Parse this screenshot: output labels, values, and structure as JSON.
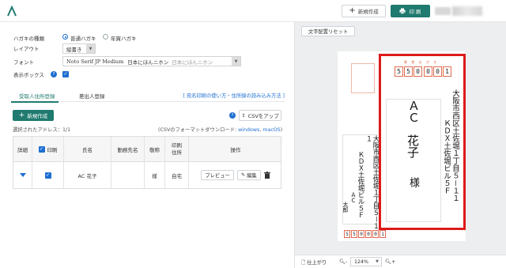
{
  "header": {
    "new_button": "新規作成",
    "print_button": "印 刷"
  },
  "form": {
    "hagaki_type_label": "ハガキの種類",
    "hagaki_options": [
      "普通ハガキ",
      "年賀ハガキ"
    ],
    "layout_label": "レイアウト",
    "layout_value": "縦書き",
    "font_label": "フォント",
    "font_value": "Noto Serif JP Medium",
    "font_sample": "日本にほんニホン",
    "font_sample2": "日本にほんニホン",
    "display_box_label": "表示ボックス"
  },
  "tabs": {
    "recipient": "受取人住所登録",
    "sender": "差出人登録",
    "help_link": "[ 宛名印刷の使い方・住所録の読み込み方法 ]"
  },
  "actions": {
    "add_button": "新規作成",
    "csv_button": "CSVをアップ",
    "selected": "選択されたアドレス：1/1",
    "csv_format_prefix": "(CSVのフォーマットダウンロード: ",
    "csv_windows": "windows",
    "csv_sep": ", ",
    "csv_mac": "macOS",
    "csv_suffix": ")"
  },
  "table": {
    "headers": [
      "詳細",
      "印刷",
      "氏名",
      "勤務先名",
      "敬称",
      "印刷住所",
      "操作"
    ],
    "row": {
      "name": "AC 花子",
      "honorific": "様",
      "address_type": "自宅",
      "preview_button": "プレビュー",
      "edit_button": "編集"
    }
  },
  "preview": {
    "reset_button": "文字配置リセット",
    "zip_hint": "郵 便 は が き",
    "recipient_zip": [
      "5",
      "5",
      "0",
      "0",
      "0",
      "1"
    ],
    "recipient_name_1": "ＡＣ",
    "recipient_name_2": "花子",
    "recipient_honorific": "様",
    "recipient_address_1": "大阪市西区土佐堀１丁目５－１１",
    "recipient_address_2": "ＫＤＸ土佐堀ビル５Ｆ",
    "sender_address_1": "大阪市西区土佐堀１丁目５－１１",
    "sender_address_2": "ＫＤＸ土佐堀ビル５Ｆ",
    "sender_name_1": "ＡＣ",
    "sender_name_2": "太郎",
    "sender_zip": [
      "5",
      "5",
      "0",
      "0",
      "0",
      "1"
    ],
    "finish_label": "仕上がり",
    "zoom": "124%"
  },
  "colors": {
    "brand": "#1f7a6f",
    "link": "#1f6fd1",
    "highlight": "#dd1a1a"
  }
}
